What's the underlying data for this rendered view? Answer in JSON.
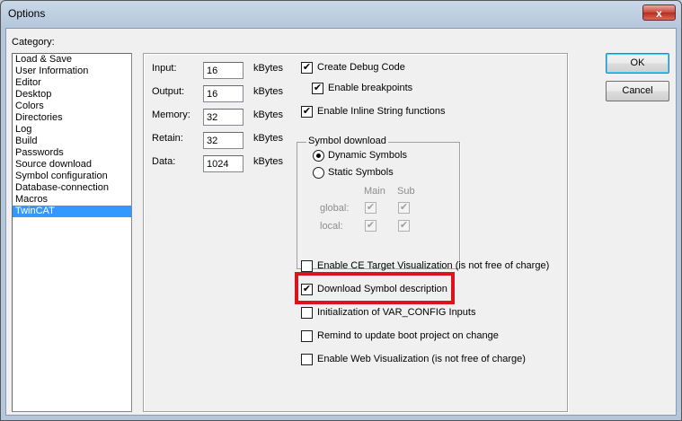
{
  "window": {
    "title": "Options",
    "close_glyph": "x",
    "close_icon": "close-icon"
  },
  "category": {
    "label": "Category:",
    "items": [
      {
        "label": "Load & Save",
        "selected": false
      },
      {
        "label": "User Information",
        "selected": false
      },
      {
        "label": "Editor",
        "selected": false
      },
      {
        "label": "Desktop",
        "selected": false
      },
      {
        "label": "Colors",
        "selected": false
      },
      {
        "label": "Directories",
        "selected": false
      },
      {
        "label": "Log",
        "selected": false
      },
      {
        "label": "Build",
        "selected": false
      },
      {
        "label": "Passwords",
        "selected": false
      },
      {
        "label": "Source download",
        "selected": false
      },
      {
        "label": "Symbol configuration",
        "selected": false
      },
      {
        "label": "Database-connection",
        "selected": false
      },
      {
        "label": "Macros",
        "selected": false
      },
      {
        "label": "TwinCAT",
        "selected": true
      }
    ]
  },
  "buttons": {
    "ok": "OK",
    "cancel": "Cancel"
  },
  "memory": {
    "unit": "kBytes",
    "fields": [
      {
        "label": "Input:",
        "value": "16"
      },
      {
        "label": "Output:",
        "value": "16"
      },
      {
        "label": "Memory:",
        "value": "32"
      },
      {
        "label": "Retain:",
        "value": "32"
      },
      {
        "label": "Data:",
        "value": "1024"
      }
    ]
  },
  "options": {
    "create_debug_code": {
      "label": "Create Debug Code",
      "checked": true
    },
    "enable_breakpoints": {
      "label": "Enable breakpoints",
      "checked": true
    },
    "enable_inline_string": {
      "label": "Enable Inline String functions",
      "checked": true
    },
    "enable_ce_target_vis": {
      "label": "Enable CE Target Visualization (is not free of charge)",
      "checked": false
    },
    "download_symbol_desc": {
      "label": "Download Symbol description",
      "checked": true
    },
    "init_var_config": {
      "label": "Initialization of VAR_CONFIG Inputs",
      "checked": false
    },
    "remind_boot_project": {
      "label": "Remind to update boot project on change",
      "checked": false
    },
    "enable_web_vis": {
      "label": "Enable Web Visualization (is not free of charge)",
      "checked": false
    }
  },
  "symbol_download": {
    "title": "Symbol download",
    "dynamic": {
      "label": "Dynamic Symbols",
      "selected": true
    },
    "static": {
      "label": "Static Symbols",
      "selected": false
    },
    "col_main": "Main",
    "col_sub": "Sub",
    "row_global": "global:",
    "row_local": "local:",
    "global_main": true,
    "global_sub": true,
    "local_main": true,
    "local_sub": true
  },
  "check_glyph": "✔",
  "highlight_color": "#d8141d"
}
